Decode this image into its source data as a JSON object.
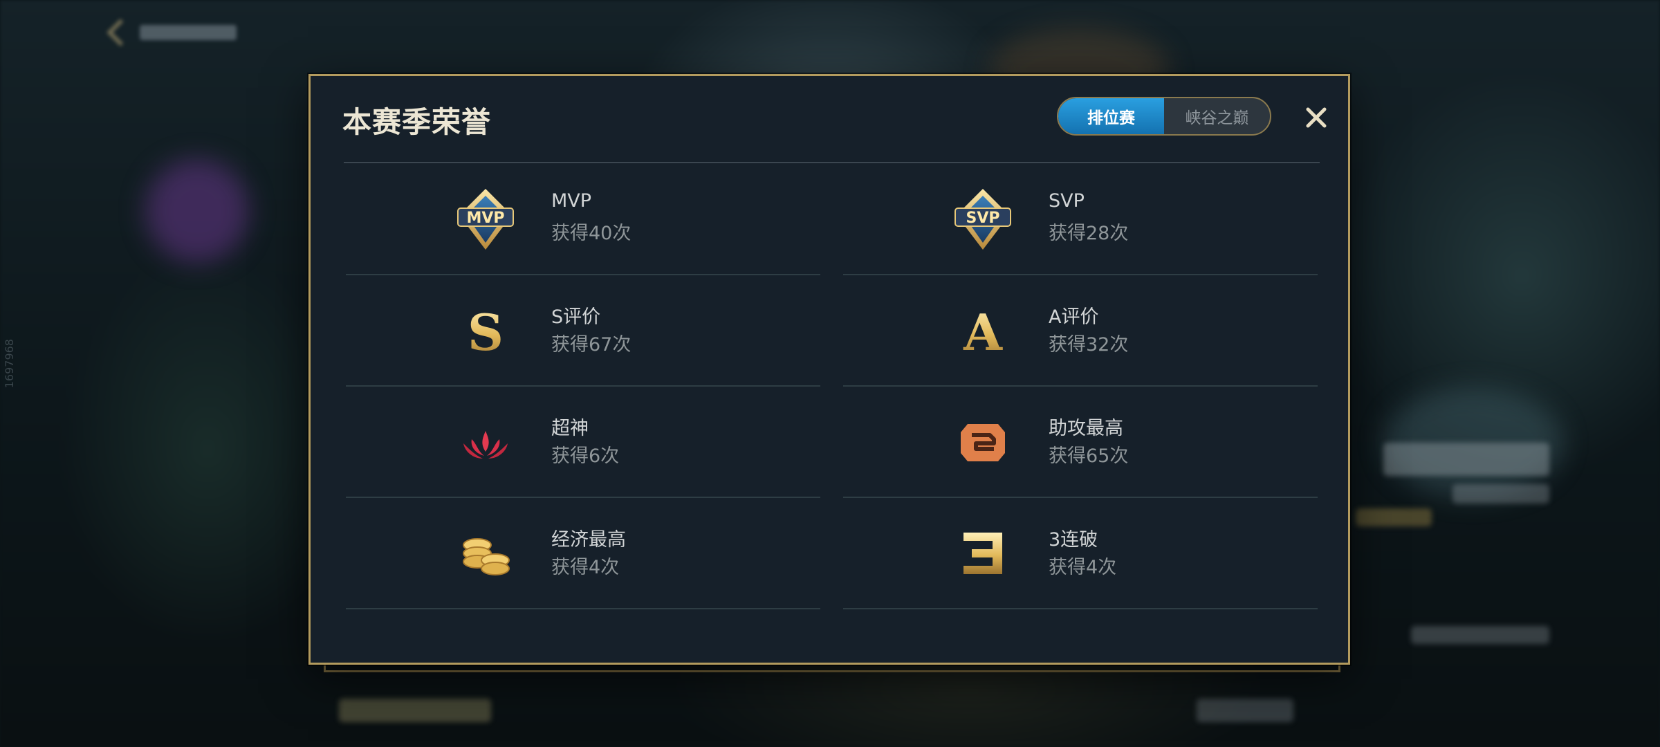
{
  "background": {
    "side_id": "1697968"
  },
  "modal": {
    "title": "本赛季荣誉",
    "tabs": [
      {
        "label": "排位赛",
        "active": true
      },
      {
        "label": "峡谷之巅",
        "active": false
      }
    ],
    "close_icon": "close-icon"
  },
  "honors": [
    {
      "icon": "mvp-badge-icon",
      "name": "MVP",
      "count": "获得40次"
    },
    {
      "icon": "svp-badge-icon",
      "name": "SVP",
      "count": "获得28次"
    },
    {
      "icon": "s-grade-icon",
      "name": "S评价",
      "count": "获得67次"
    },
    {
      "icon": "a-grade-icon",
      "name": "A评价",
      "count": "获得32次"
    },
    {
      "icon": "legendary-flame-icon",
      "name": "超神",
      "count": "获得6次"
    },
    {
      "icon": "assist-icon",
      "name": "助攻最高",
      "count": "获得65次"
    },
    {
      "icon": "gold-coins-icon",
      "name": "经济最高",
      "count": "获得4次"
    },
    {
      "icon": "triple-kill-icon",
      "name": "3连破",
      "count": "获得4次"
    }
  ],
  "colors": {
    "accent_gold": "#b39b5e",
    "tab_active": "#1f8ccc",
    "panel": "#16202a",
    "flame_red": "#d9304a",
    "assist_orange": "#e0804a"
  }
}
